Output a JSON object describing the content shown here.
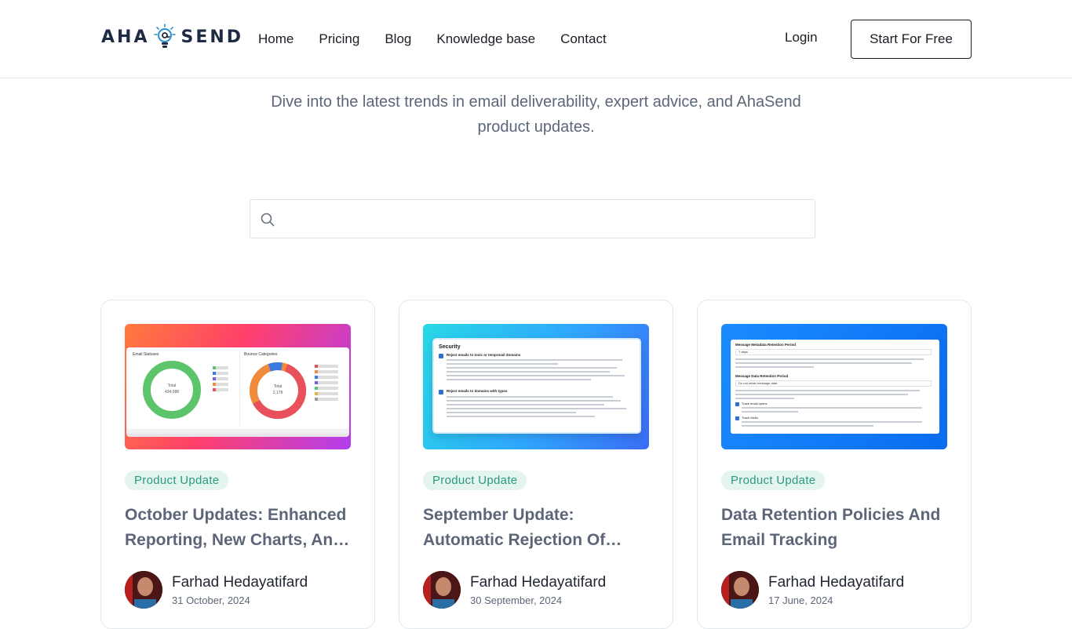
{
  "brand": {
    "left": "AHA",
    "right": "SEND"
  },
  "nav": {
    "items": [
      "Home",
      "Pricing",
      "Blog",
      "Knowledge base",
      "Contact"
    ],
    "login": "Login",
    "cta": "Start For Free"
  },
  "intro": {
    "text": "Dive into the latest trends in email deliverability, expert advice, and AhaSend product updates."
  },
  "search": {
    "placeholder": "",
    "value": ""
  },
  "colors": {
    "accent": "#2a9a7e",
    "badge_bg": "#e4f4ef",
    "title_text": "#5c6678"
  },
  "posts": [
    {
      "category": "Product Update",
      "title": "October Updates: Enhanced Reporting, New Charts, And More",
      "author": "Farhad Hedayatifard",
      "date": "31 October, 2024",
      "thumb": {
        "left_panel": "Email Statuses",
        "right_panel": "Bounce Categories",
        "donut1_label": "Total",
        "donut1_value": "434,088",
        "donut2_label": "Total",
        "donut2_value": "2,178"
      }
    },
    {
      "category": "Product Update",
      "title": "September Update: Automatic Rejection Of Toxic Domains",
      "author": "Farhad Hedayatifard",
      "date": "30 September, 2024",
      "thumb": {
        "heading": "Security",
        "option1": "Reject emails to toxic or temprmail domains",
        "option2": "Reject emails to domains with typos"
      }
    },
    {
      "category": "Product Update",
      "title": "Data Retention Policies And Email Tracking",
      "author": "Farhad Hedayatifard",
      "date": "17 June, 2024",
      "thumb": {
        "field1": "Message Metadata Retention Period",
        "value1": "7 days",
        "field2": "Message Data Retention Period",
        "value2": "Do not retain message data",
        "check1": "Track email opens",
        "check2": "Track clicks"
      }
    }
  ]
}
